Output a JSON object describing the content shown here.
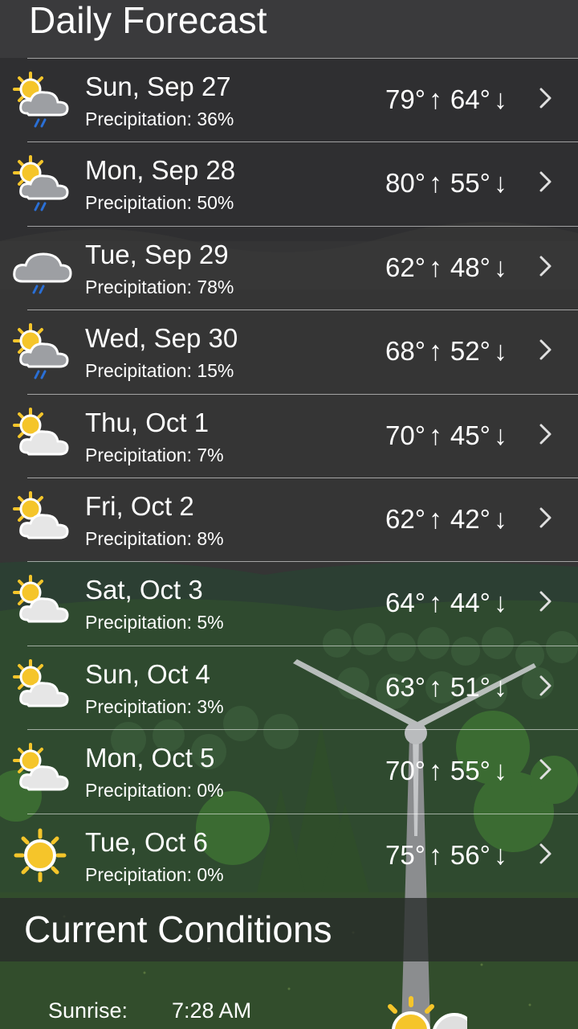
{
  "header": {
    "title": "Daily Forecast"
  },
  "forecast": [
    {
      "day": "Sun, Sep 27",
      "precip": "Precipitation: 36%",
      "high": "79°",
      "low": "64°",
      "icon": "partly-cloudy-rain-icon"
    },
    {
      "day": "Mon, Sep 28",
      "precip": "Precipitation: 50%",
      "high": "80°",
      "low": "55°",
      "icon": "partly-cloudy-rain-icon"
    },
    {
      "day": "Tue, Sep 29",
      "precip": "Precipitation: 78%",
      "high": "62°",
      "low": "48°",
      "icon": "cloud-rain-icon"
    },
    {
      "day": "Wed, Sep 30",
      "precip": "Precipitation: 15%",
      "high": "68°",
      "low": "52°",
      "icon": "partly-cloudy-rain-icon"
    },
    {
      "day": "Thu, Oct 1",
      "precip": "Precipitation: 7%",
      "high": "70°",
      "low": "45°",
      "icon": "partly-cloudy-icon"
    },
    {
      "day": "Fri, Oct 2",
      "precip": "Precipitation: 8%",
      "high": "62°",
      "low": "42°",
      "icon": "partly-cloudy-icon"
    },
    {
      "day": "Sat, Oct 3",
      "precip": "Precipitation: 5%",
      "high": "64°",
      "low": "44°",
      "icon": "partly-cloudy-icon"
    },
    {
      "day": "Sun, Oct 4",
      "precip": "Precipitation: 3%",
      "high": "63°",
      "low": "51°",
      "icon": "partly-cloudy-icon"
    },
    {
      "day": "Mon, Oct 5",
      "precip": "Precipitation: 0%",
      "high": "70°",
      "low": "55°",
      "icon": "partly-cloudy-icon"
    },
    {
      "day": "Tue, Oct 6",
      "precip": "Precipitation: 0%",
      "high": "75°",
      "low": "56°",
      "icon": "sun-icon"
    }
  ],
  "arrows": {
    "up": "↑",
    "down": "↓"
  },
  "current": {
    "title": "Current Conditions",
    "sunrise_label": "Sunrise:",
    "sunrise_value": "7:28 AM"
  },
  "colors": {
    "sun": "#f5c52a",
    "cloud": "#e4e4e4",
    "rain": "#2a6fd6",
    "header_bg": "#3a3a3c"
  }
}
